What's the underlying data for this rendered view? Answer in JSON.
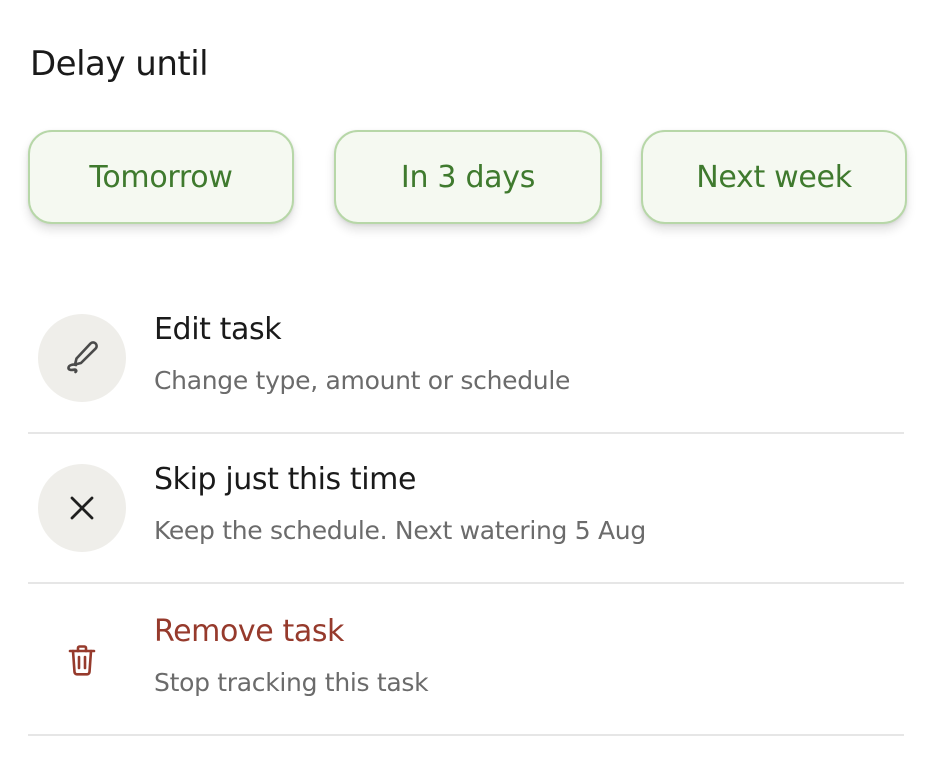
{
  "heading": "Delay until",
  "delay_options": [
    {
      "label": "Tomorrow"
    },
    {
      "label": "In 3 days"
    },
    {
      "label": "Next week"
    }
  ],
  "actions": [
    {
      "title": "Edit task",
      "subtitle": "Change type, amount or schedule",
      "icon": "pencil-icon"
    },
    {
      "title": "Skip just this time",
      "subtitle": "Keep the schedule. Next watering 5 Aug",
      "icon": "close-icon"
    },
    {
      "title": "Remove task",
      "subtitle": "Stop tracking this task",
      "icon": "trash-icon"
    }
  ],
  "colors": {
    "chip_text": "#3f7a2e",
    "chip_border": "#b7d7a8",
    "chip_bg": "#f5f9f1",
    "danger": "#963a2c",
    "icon_circle_bg": "#efeeea"
  }
}
